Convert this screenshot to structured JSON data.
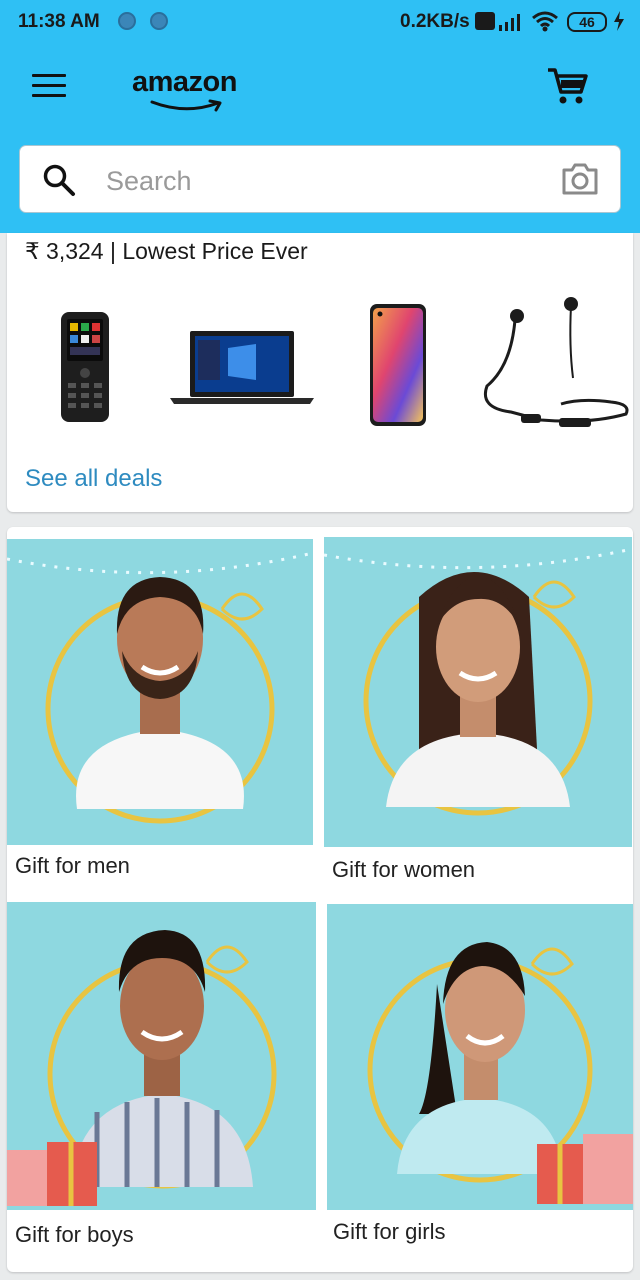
{
  "status_bar": {
    "time": "11:38 AM",
    "net_speed": "0.2KB/s",
    "battery": "46"
  },
  "header": {
    "logo_text": "amazon",
    "search_placeholder": "Search"
  },
  "deals": {
    "price_line": "₹ 3,324 | Lowest Price Ever",
    "products": [
      "feature-phone",
      "laptop",
      "smartphone",
      "neckband-earphones"
    ],
    "see_all_label": "See all deals"
  },
  "gifts": [
    {
      "label": "Gift for men"
    },
    {
      "label": "Gift for women"
    },
    {
      "label": "Gift for boys"
    },
    {
      "label": "Gift for girls"
    }
  ],
  "colors": {
    "header_bg": "#2fc0f4",
    "gift_bg": "#8ed8e0",
    "link": "#2e8bc0",
    "gold_ring": "#e8c441"
  }
}
